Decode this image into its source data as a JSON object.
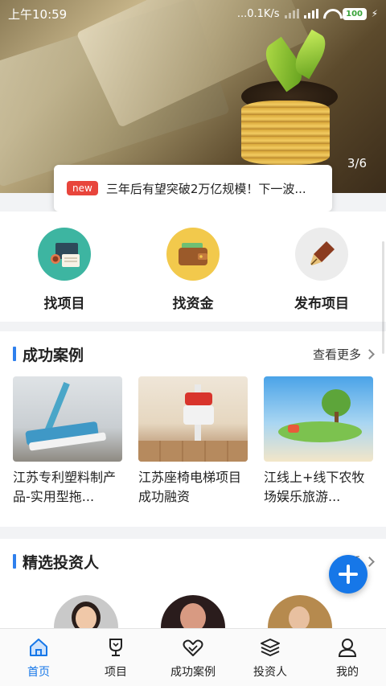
{
  "status_bar": {
    "time": "上午10:59",
    "network": "...0.1K/s",
    "battery": "100"
  },
  "banner": {
    "counter": "3/6",
    "news_badge": "new",
    "news_text": "三年后有望突破2万亿规模！下一波..."
  },
  "quick_actions": [
    {
      "label": "找项目",
      "icon": "project-icon"
    },
    {
      "label": "找资金",
      "icon": "wallet-icon"
    },
    {
      "label": "发布项目",
      "icon": "pen-icon"
    }
  ],
  "success_cases": {
    "title": "成功案例",
    "more": "查看更多",
    "items": [
      {
        "caption": "江苏专利塑料制产品-实用型拖..."
      },
      {
        "caption": "江苏座椅电梯项目成功融资"
      },
      {
        "caption": "江线上+线下农牧场娱乐旅游..."
      }
    ]
  },
  "investors": {
    "title": "精选投资人",
    "more": "查看"
  },
  "tabbar": [
    {
      "label": "首页",
      "active": true
    },
    {
      "label": "项目",
      "active": false
    },
    {
      "label": "成功案例",
      "active": false
    },
    {
      "label": "投资人",
      "active": false
    },
    {
      "label": "我的",
      "active": false
    }
  ],
  "colors": {
    "accent": "#1677e8",
    "badge": "#e8453c"
  }
}
